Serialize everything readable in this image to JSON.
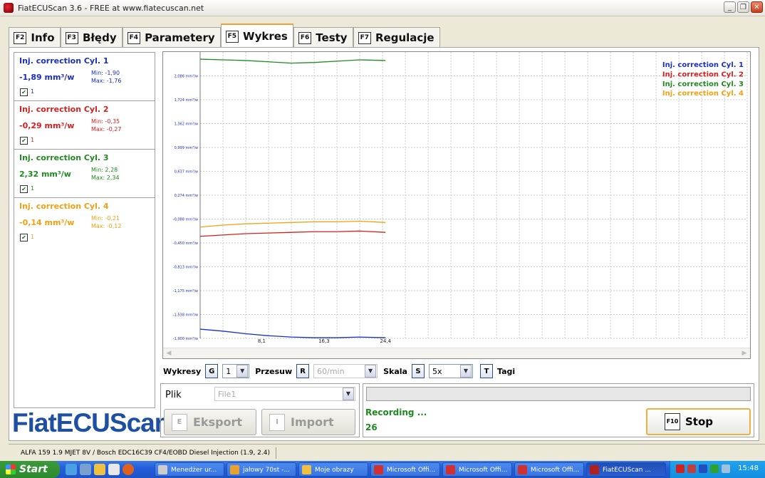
{
  "window": {
    "title": "FiatECUScan 3.6 - FREE at www.fiatecuscan.net"
  },
  "tabs": [
    {
      "key": "F2",
      "label": "Info"
    },
    {
      "key": "F3",
      "label": "Błędy"
    },
    {
      "key": "F4",
      "label": "Parametery"
    },
    {
      "key": "F5",
      "label": "Wykres"
    },
    {
      "key": "F6",
      "label": "Testy"
    },
    {
      "key": "F7",
      "label": "Regulacje"
    }
  ],
  "active_tab": "Wykres",
  "colors": {
    "cyl1": "#1a2ec0",
    "cyl2": "#d42020",
    "cyl3": "#1f8a1f",
    "cyl4": "#f0a010"
  },
  "cylinders": [
    {
      "title": "Inj. correction Cyl. 1",
      "value": "-1,89 mm³/w",
      "min": "Min: -1,90",
      "max": "Max: -1,76",
      "checked": true,
      "check_label": "1"
    },
    {
      "title": "Inj. correction Cyl. 2",
      "value": "-0,29 mm³/w",
      "min": "Min: -0,35",
      "max": "Max: -0,27",
      "checked": true,
      "check_label": "1"
    },
    {
      "title": "Inj. correction Cyl. 3",
      "value": "2,32 mm³/w",
      "min": "Min: 2,28",
      "max": "Max: 2,34",
      "checked": true,
      "check_label": "1"
    },
    {
      "title": "Inj. correction Cyl. 4",
      "value": "-0,14 mm³/w",
      "min": "Min: -0,21",
      "max": "Max: -0,12",
      "checked": true,
      "check_label": "1"
    }
  ],
  "logo_text": "FiatECUScan",
  "chart_data": {
    "type": "line",
    "ylim": [
      -1.9,
      2.449
    ],
    "xlim": [
      0,
      72
    ],
    "y_ticks": [
      {
        "value": 2.086,
        "label": "2,086 mm³/w"
      },
      {
        "value": 1.724,
        "label": "1,724 mm³/w"
      },
      {
        "value": 1.362,
        "label": "1,362 mm³/w"
      },
      {
        "value": 0.999,
        "label": "0,999 mm³/w"
      },
      {
        "value": 0.637,
        "label": "0,637 mm³/w"
      },
      {
        "value": 0.274,
        "label": "0,274 mm³/w"
      },
      {
        "value": -0.088,
        "label": "-0,088 mm³/w"
      },
      {
        "value": -0.45,
        "label": "-0,450 mm³/w"
      },
      {
        "value": -0.813,
        "label": "-0,813 mm³/w"
      },
      {
        "value": -1.175,
        "label": "-1,175 mm³/w"
      },
      {
        "value": -1.538,
        "label": "-1,538 mm³/w"
      },
      {
        "value": -1.9,
        "label": "-1,900 mm³/w"
      }
    ],
    "x_ticks": [
      {
        "value": 8.1,
        "label": "8,1"
      },
      {
        "value": 16.3,
        "label": "16,3"
      },
      {
        "value": 24.4,
        "label": "24,4"
      }
    ],
    "legend": [
      "Inj. correction Cyl. 1",
      "Inj. correction Cyl. 2",
      "Inj. correction Cyl. 3",
      "Inj. correction Cyl. 4"
    ],
    "legend_position": "top-right",
    "grid": true,
    "series": [
      {
        "name": "Inj. correction Cyl. 1",
        "color": "#1a2ec0",
        "x": [
          0,
          3,
          6,
          9,
          12,
          15,
          18,
          21,
          24.4
        ],
        "values": [
          -1.76,
          -1.79,
          -1.83,
          -1.86,
          -1.88,
          -1.89,
          -1.89,
          -1.88,
          -1.89
        ]
      },
      {
        "name": "Inj. correction Cyl. 2",
        "color": "#d42020",
        "x": [
          0,
          3,
          6,
          9,
          12,
          15,
          18,
          21,
          24.4
        ],
        "values": [
          -0.35,
          -0.33,
          -0.31,
          -0.3,
          -0.29,
          -0.28,
          -0.28,
          -0.27,
          -0.29
        ]
      },
      {
        "name": "Inj. correction Cyl. 3",
        "color": "#1f8a1f",
        "x": [
          0,
          3,
          6,
          9,
          12,
          15,
          18,
          21,
          24.4
        ],
        "values": [
          2.34,
          2.33,
          2.32,
          2.3,
          2.28,
          2.29,
          2.31,
          2.33,
          2.32
        ]
      },
      {
        "name": "Inj. correction Cyl. 4",
        "color": "#f0a010",
        "x": [
          0,
          3,
          6,
          9,
          12,
          15,
          18,
          21,
          24.4
        ],
        "values": [
          -0.21,
          -0.18,
          -0.16,
          -0.15,
          -0.14,
          -0.13,
          -0.13,
          -0.12,
          -0.14
        ]
      }
    ]
  },
  "controls": {
    "wykresy_label": "Wykresy",
    "wykresy_key": "G",
    "wykresy_value": "1",
    "przesuw_label": "Przesuw",
    "przesuw_key": "R",
    "przesuw_value": "60/min",
    "skala_label": "Skala",
    "skala_key": "S",
    "skala_value": "5x",
    "tagi_key": "T",
    "tagi_label": "Tagi"
  },
  "file_panel": {
    "label": "Plik",
    "file_value": "File1",
    "export_key": "E",
    "export_label": "Eksport",
    "import_key": "I",
    "import_label": "Import"
  },
  "status": {
    "recording": "Recording ...",
    "counter": "26",
    "stop_key": "F10",
    "stop_label": "Stop"
  },
  "ecu_info": "ALFA 159 1.9 MJET 8V / Bosch EDC16C39 CF4/EOBD Diesel Injection (1.9, 2.4)",
  "taskbar": {
    "start_label": "Start",
    "tasks": [
      "Menedżer ur...",
      "jałowy 70st -...",
      "Moje obrazy",
      "Microsoft Offi...",
      "Microsoft Offi...",
      "Microsoft Offi...",
      "FiatECUScan ..."
    ],
    "clock": "15:48"
  }
}
